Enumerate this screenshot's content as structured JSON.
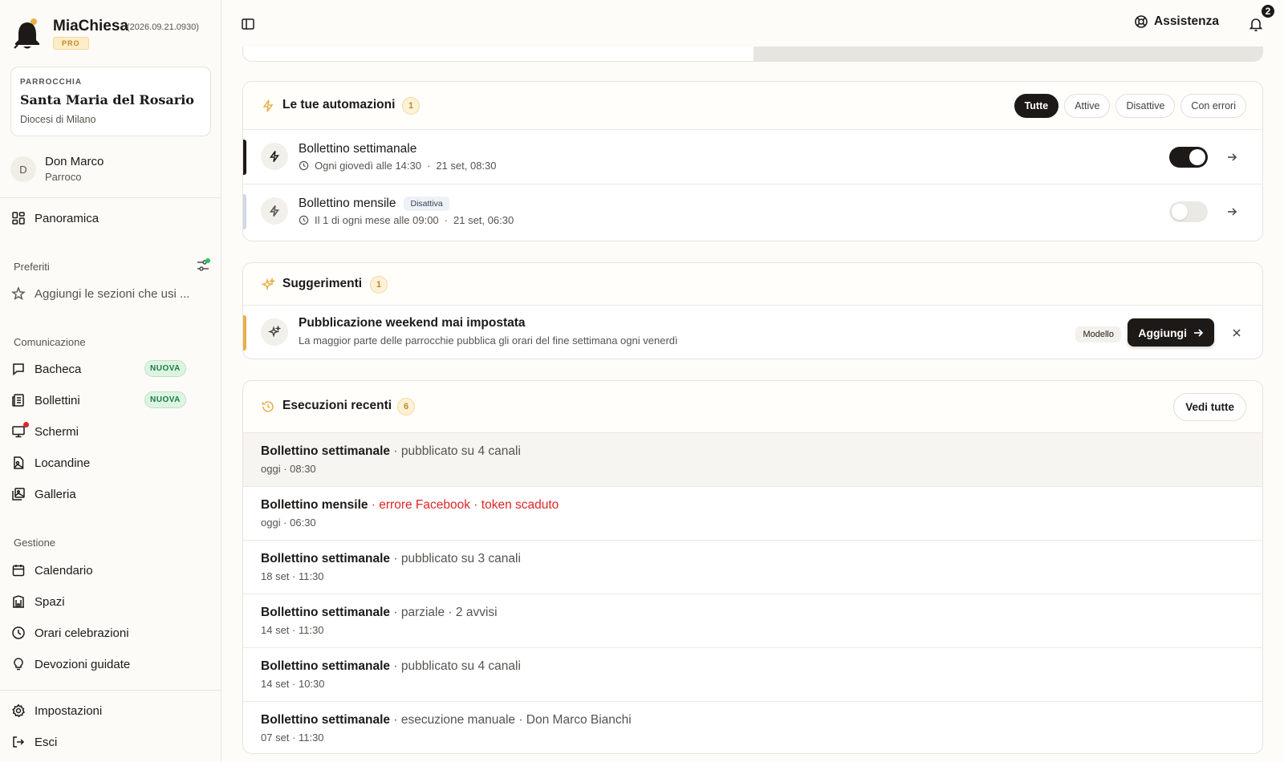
{
  "app": {
    "name": "MiaChiesa",
    "version": "(2026.09.21.0930)",
    "plan": "PRO"
  },
  "parish": {
    "caption": "PARROCCHIA",
    "name": "Santa Maria del Rosario",
    "diocese": "Diocesi di Milano"
  },
  "user": {
    "initial": "D",
    "name": "Don Marco",
    "role": "Parroco"
  },
  "sidebar": {
    "overview": "Panoramica",
    "favorites_label": "Preferiti",
    "favorites_empty": "Aggiungi le sezioni che usi ...",
    "communication_label": "Comunicazione",
    "communication": [
      {
        "label": "Bacheca",
        "badge": "NUOVA"
      },
      {
        "label": "Bollettini",
        "badge": "NUOVA"
      },
      {
        "label": "Schermi"
      },
      {
        "label": "Locandine"
      },
      {
        "label": "Galleria"
      }
    ],
    "management_label": "Gestione",
    "management": [
      {
        "label": "Calendario"
      },
      {
        "label": "Spazi"
      },
      {
        "label": "Orari celebrazioni"
      },
      {
        "label": "Devozioni guidate"
      }
    ],
    "settings": "Impostazioni",
    "logout": "Esci"
  },
  "topbar": {
    "help": "Assistenza",
    "notifications": "2"
  },
  "automations": {
    "title": "Le tue automazioni",
    "count": "1",
    "filters": [
      "Tutte",
      "Attive",
      "Disattive",
      "Con errori"
    ],
    "items": [
      {
        "title": "Bollettino settimanale",
        "schedule": "Ogni giovedì alle 14:30",
        "sep": "·",
        "last": "21 set, 08:30",
        "tag": "",
        "active": true
      },
      {
        "title": "Bollettino mensile",
        "schedule": "Il 1 di ogni mese alle 09:00",
        "sep": "·",
        "last": "21 set, 06:30",
        "tag": "Disattiva",
        "active": false
      }
    ]
  },
  "suggestions": {
    "title": "Suggerimenti",
    "count": "1",
    "item": {
      "title": "Pubblicazione weekend mai impostata",
      "desc": "La maggior parte delle parrocchie pubblica gli orari del fine settimana ogni venerdì",
      "tag": "Modello",
      "action": "Aggiungi"
    }
  },
  "executions": {
    "title": "Esecuzioni recenti",
    "count": "6",
    "see_all": "Vedi tutte",
    "items": [
      {
        "name": "Bollettino settimanale",
        "detail": " · pubblicato su 4 canali",
        "when": "oggi · 08:30",
        "error": false
      },
      {
        "name": "Bollettino mensile",
        "detail": " · errore Facebook · token scaduto",
        "when": "oggi · 06:30",
        "error": true
      },
      {
        "name": "Bollettino settimanale",
        "detail": " · pubblicato su 3 canali",
        "when": "18 set · 11:30",
        "error": false
      },
      {
        "name": "Bollettino settimanale",
        "detail": " · parziale · 2 avvisi",
        "when": "14 set · 11:30",
        "error": false
      },
      {
        "name": "Bollettino settimanale",
        "detail": " · pubblicato su 4 canali",
        "when": "14 set · 10:30",
        "error": false
      },
      {
        "name": "Bollettino settimanale",
        "detail": " · esecuzione manuale · Don Marco Bianchi",
        "when": "07 set · 11:30",
        "error": false
      }
    ]
  },
  "colors": {
    "accent_dark": "#1c1917",
    "accent_amber": "#e8b04a",
    "accent_inactive": "#cfd8e3",
    "error": "#dc2626",
    "new_badge": "#15803d"
  }
}
